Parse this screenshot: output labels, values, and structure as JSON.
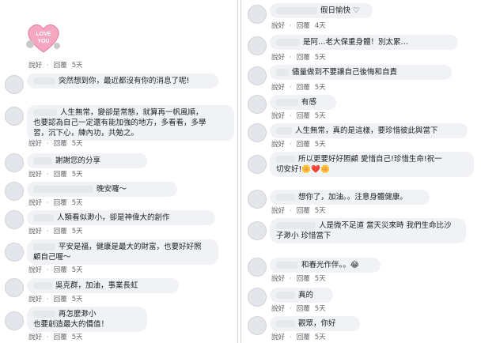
{
  "actions": {
    "like": "說好",
    "reply": "回覆"
  },
  "left": [
    {
      "text": "",
      "time": "5天",
      "sticker": "LOVE YOU"
    },
    {
      "text": "突然想到你，最近都沒有你的消息了呢!",
      "time": "5天"
    },
    {
      "text": "人生無常，變卻是常態，就算再一帆風順，",
      "text2": "也要認為自己一定還有能加強的地方，多看看，多學",
      "text3": "習，沉下心，練內功，共勉之。",
      "time": "5天"
    },
    {
      "text": "謝謝您的分享",
      "time": "5天"
    },
    {
      "text": "晚安囉～",
      "time": "5天"
    },
    {
      "text": "人類看似渺小，卻是神偉大的創作",
      "time": "5天"
    },
    {
      "text": "平安是福，健康是最大的財富，也要好好照",
      "text2": "顧自己喔～",
      "time": "5天"
    },
    {
      "text": "吳克群，加油，事業長虹",
      "time": "5天"
    },
    {
      "text": "再怎麼渺小",
      "text2": "也要創造最大的價值！",
      "time": "5天"
    }
  ],
  "right": [
    {
      "text": "假日愉快 ♡",
      "time": "4天"
    },
    {
      "text": "是阿…老大保重身體！別太累…",
      "time": "5天"
    },
    {
      "text": "儘量做到不要讓自己後悔和自責",
      "time": "5天"
    },
    {
      "text": "有感",
      "time": "5天"
    },
    {
      "text": "人生無常，真的是這樣，要珍惜彼此與當下",
      "time": "5天"
    },
    {
      "text": "所以更要好好照顧 愛惜自己!珍惜生命!祝一",
      "text2": "切安好!🌼❤️🌼",
      "time": "5天"
    },
    {
      "text": "想你了，加油。。注意身體健康。",
      "time": "5天"
    },
    {
      "text": "人是微不足道 當天災來時 我們生命比沙",
      "text2": "子渺小 珍惜當下",
      "time": "5天"
    },
    {
      "text": "和春光作伴。。😂",
      "time": "5天"
    },
    {
      "text": "真的",
      "time": "5天"
    },
    {
      "text": "觀眾，你好",
      "time": "5天"
    }
  ]
}
